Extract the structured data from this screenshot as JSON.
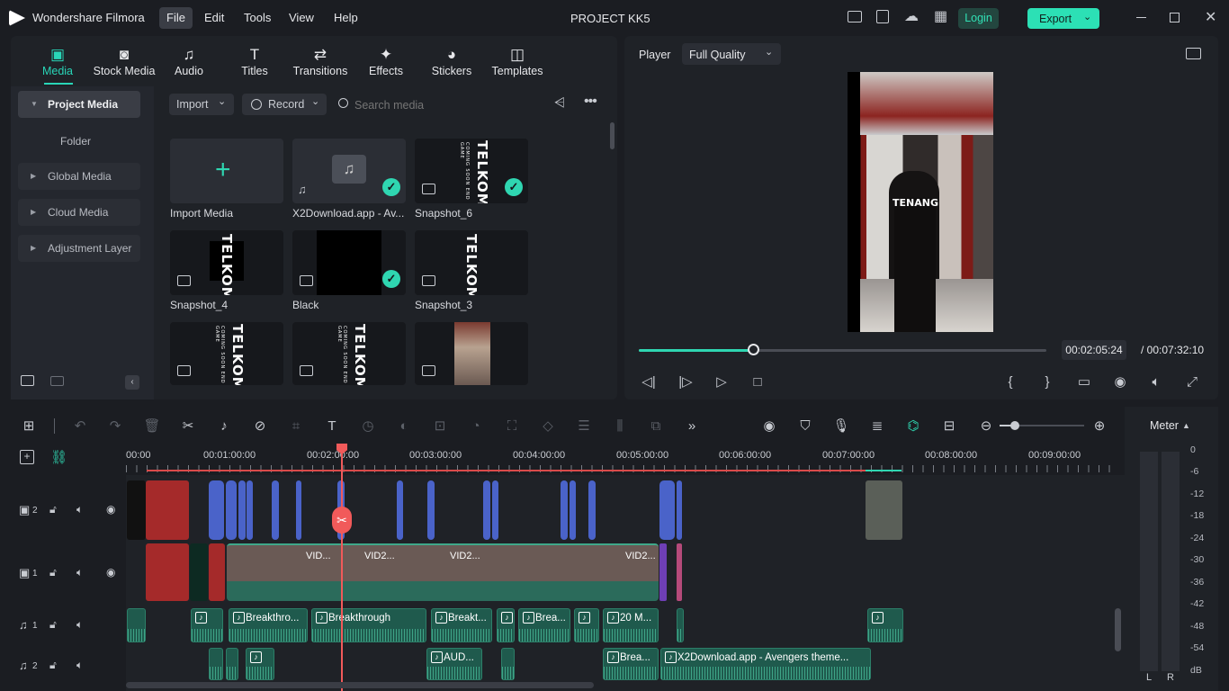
{
  "app": {
    "name": "Wondershare Filmora",
    "project": "PROJECT KK5",
    "login": "Login",
    "export": "Export"
  },
  "menu": [
    "File",
    "Edit",
    "Tools",
    "View",
    "Help"
  ],
  "tabs": [
    "Media",
    "Stock Media",
    "Audio",
    "Titles",
    "Transitions",
    "Effects",
    "Stickers",
    "Templates"
  ],
  "sidebar": {
    "project_media": "Project Media",
    "folder": "Folder",
    "items": [
      "Global Media",
      "Cloud Media",
      "Adjustment Layer"
    ]
  },
  "media_toolbar": {
    "import": "Import",
    "record": "Record",
    "search_placeholder": "Search media"
  },
  "media": [
    {
      "label": "Import Media"
    },
    {
      "label": "X2Download.app - Av..."
    },
    {
      "label": "Snapshot_6",
      "text": "TELKOM",
      "sub": "COMING SOON END GAME"
    },
    {
      "label": "Snapshot_4",
      "text": "TELKOM"
    },
    {
      "label": "Black"
    },
    {
      "label": "Snapshot_3",
      "text": "TELKOM"
    },
    {
      "text": "TELKOM",
      "sub": "COMING SOON END GAME"
    },
    {
      "text": "TELKOM",
      "sub": "COMING SOON END GAME"
    }
  ],
  "player": {
    "label": "Player",
    "quality": "Full Quality",
    "current": "00:02:05:24",
    "total": "/ 00:07:32:10",
    "overlay_text": "TENANG",
    "progress": 0.28
  },
  "meter": {
    "label": "Meter",
    "scale": [
      "0",
      "-6",
      "-12",
      "-18",
      "-24",
      "-30",
      "-36",
      "-42",
      "-48",
      "-54",
      "dB"
    ],
    "left": "L",
    "right": "R"
  },
  "ruler": [
    "00:00",
    "00:01:00:00",
    "00:02:00:00",
    "00:03:00:00",
    "00:04:00:00",
    "00:05:00:00",
    "00:06:00:00",
    "00:07:00:00",
    "00:08:00:00",
    "00:09:00:00"
  ],
  "tracks": {
    "v2": "2",
    "v1": "1",
    "a1": "1",
    "a2": "2"
  },
  "clips": {
    "a1": [
      "Breakthro...",
      "Breakthrough",
      "Breakt...",
      "Brea...",
      "20 M..."
    ],
    "a2": [
      "AUD...",
      "Brea...",
      "X2Download.app - Avengers theme..."
    ],
    "v1": [
      "VID...",
      "VID2...",
      "VID2...",
      "VID2..."
    ]
  }
}
